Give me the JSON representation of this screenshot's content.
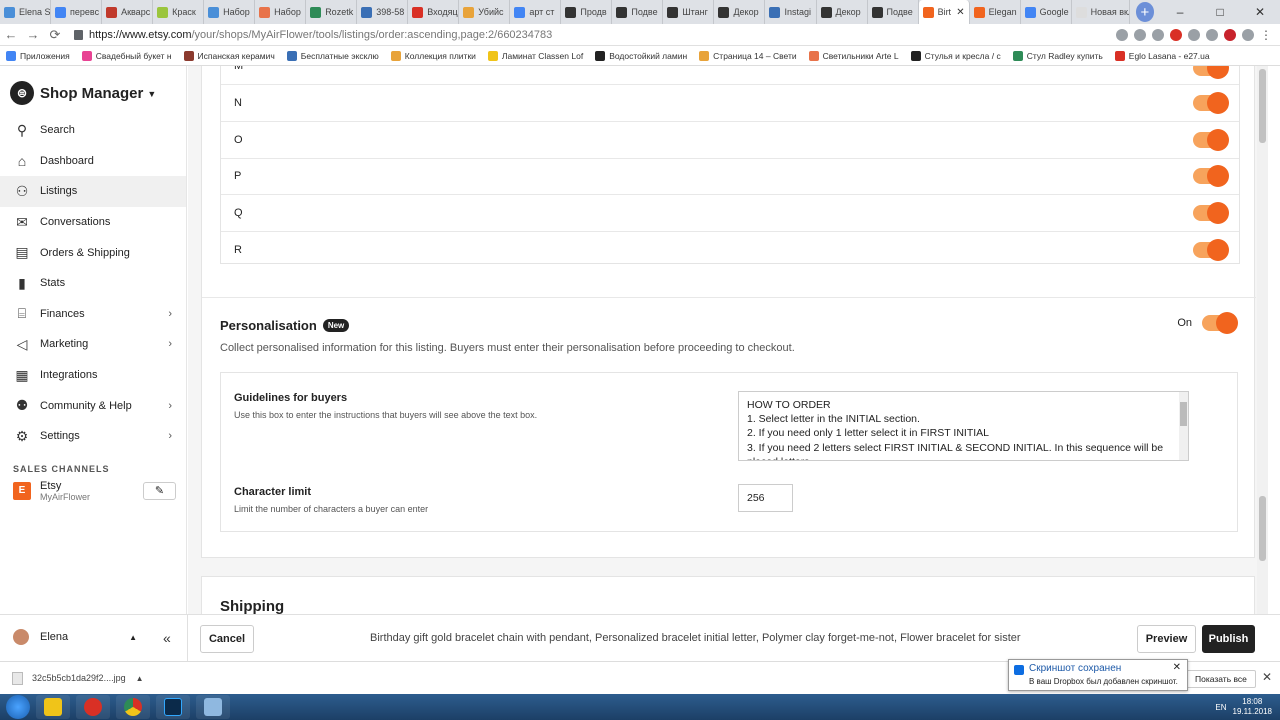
{
  "browser": {
    "tabs": [
      {
        "label": "Elena S",
        "color": "#4a8fd8"
      },
      {
        "label": "перевс",
        "color": "#4285f4"
      },
      {
        "label": "Акварс",
        "color": "#c0392b"
      },
      {
        "label": "Краск",
        "color": "#9bc53d"
      },
      {
        "label": "Набор",
        "color": "#4a8fd8"
      },
      {
        "label": "Набор",
        "color": "#e8734a"
      },
      {
        "label": "Rozetk",
        "color": "#2e8b57"
      },
      {
        "label": "398-58",
        "color": "#3a6fb5"
      },
      {
        "label": "Входяц",
        "color": "#d93025"
      },
      {
        "label": "Убийс",
        "color": "#e8a33a"
      },
      {
        "label": "арт ст",
        "color": "#4285f4"
      },
      {
        "label": "Продв",
        "color": "#333333"
      },
      {
        "label": "Подве",
        "color": "#333333"
      },
      {
        "label": "Штанг",
        "color": "#333333"
      },
      {
        "label": "Декор",
        "color": "#333333"
      },
      {
        "label": "Instagi",
        "color": "#3a6fb5"
      },
      {
        "label": "Декор",
        "color": "#333333"
      },
      {
        "label": "Подве",
        "color": "#333333"
      },
      {
        "label": "Birt",
        "color": "#f1641e",
        "active": true
      },
      {
        "label": "Elegan",
        "color": "#f1641e"
      },
      {
        "label": "Google",
        "color": "#4285f4"
      },
      {
        "label": "Новая вкла",
        "color": "#dddddd"
      }
    ],
    "url_domain": "https://www.etsy.com",
    "url_path": "/your/shops/MyAirFlower/tools/listings/order:ascending,page:2/660234783",
    "bookmarks": [
      {
        "label": "Приложения",
        "color": "#4285f4"
      },
      {
        "label": "Свадебный букет н",
        "color": "#e84393"
      },
      {
        "label": "Испанская керамич",
        "color": "#8b3a2e"
      },
      {
        "label": "Бесплатные эксклю",
        "color": "#3a6fb5"
      },
      {
        "label": "Коллекция плитки",
        "color": "#e8a33a"
      },
      {
        "label": "Ламинат Classen Lof",
        "color": "#f0c419"
      },
      {
        "label": "Водостойкий ламин",
        "color": "#222222"
      },
      {
        "label": "Страница 14 – Свети",
        "color": "#e8a33a"
      },
      {
        "label": "Светильники Arte L",
        "color": "#e8734a"
      },
      {
        "label": "Стулья и кресла / с",
        "color": "#222222"
      },
      {
        "label": "Стул Radley купить",
        "color": "#2e8b57"
      },
      {
        "label": "Eglo Lasana - e27.ua",
        "color": "#d93025"
      }
    ]
  },
  "sidebar": {
    "title": "Shop Manager",
    "items": [
      {
        "label": "Search",
        "icon": "search-icon"
      },
      {
        "label": "Dashboard",
        "icon": "home-icon"
      },
      {
        "label": "Listings",
        "icon": "listings-icon",
        "active": true
      },
      {
        "label": "Conversations",
        "icon": "mail-icon"
      },
      {
        "label": "Orders & Shipping",
        "icon": "clipboard-icon"
      },
      {
        "label": "Stats",
        "icon": "bar-chart-icon"
      },
      {
        "label": "Finances",
        "icon": "bank-icon",
        "chevron": true
      },
      {
        "label": "Marketing",
        "icon": "megaphone-icon",
        "chevron": true
      },
      {
        "label": "Integrations",
        "icon": "grid-icon"
      },
      {
        "label": "Community & Help",
        "icon": "people-icon",
        "chevron": true
      },
      {
        "label": "Settings",
        "icon": "gear-icon",
        "chevron": true
      }
    ],
    "sales_channels_heading": "SALES CHANNELS",
    "channel": {
      "badge": "E",
      "name": "Etsy",
      "shop": "MyAirFlower"
    }
  },
  "letters": {
    "rows": [
      "M",
      "N",
      "O",
      "P",
      "Q",
      "R"
    ]
  },
  "personalisation": {
    "title": "Personalisation",
    "badge": "New",
    "on_label": "On",
    "description": "Collect personalised information for this listing. Buyers must enter their personalisation before proceeding to checkout.",
    "guidelines_title": "Guidelines for buyers",
    "guidelines_desc": "Use this box to enter the instructions that buyers will see above the text box.",
    "guidelines_lines": [
      "HOW TO ORDER",
      "1. Select letter in the INITIAL section.",
      "2.  If you need only 1 letter select it in FIRST INITIAL",
      "3. If you need 2 letters  select FIRST INITIAL & SECOND INITIAL. In this sequence will be",
      "placed letters."
    ],
    "char_limit_title": "Character limit",
    "char_limit_desc": "Limit the number of characters a buyer can enter",
    "char_limit_value": "256"
  },
  "shipping": {
    "title": "Shipping"
  },
  "actionbar": {
    "user_name": "Elena",
    "cancel_label": "Cancel",
    "listing_title": "Birthday gift gold bracelet chain with pendant, Personalized bracelet initial letter, Polymer clay forget-me-not, Flower bracelet for sister",
    "preview_label": "Preview",
    "publish_label": "Publish"
  },
  "downloads": {
    "file": "32c5b5cb1da29f2....jpg",
    "show_all": "Показать все"
  },
  "toast": {
    "title": "Скриншот сохранен",
    "body": "В ваш Dropbox был добавлен скриншот."
  },
  "taskbar": {
    "lang": "EN",
    "time": "18:08",
    "date": "19.11.2018"
  },
  "colors": {
    "accent": "#f1641e",
    "toggle_track": "#f7a35c"
  }
}
